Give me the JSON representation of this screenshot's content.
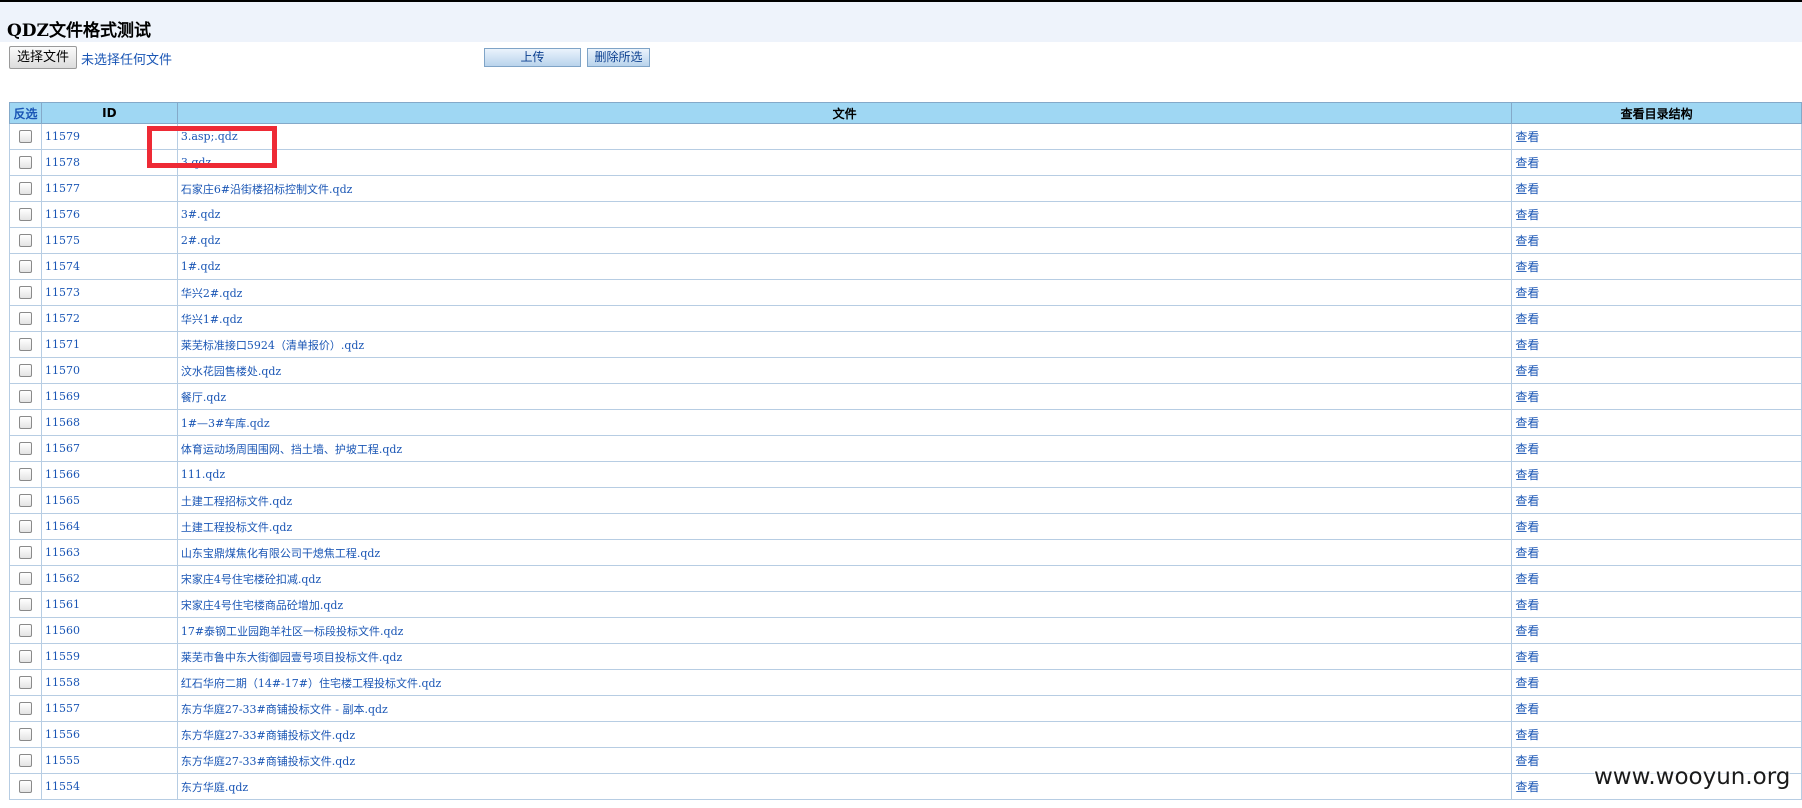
{
  "page": {
    "title": "QDZ文件格式测试"
  },
  "toolbar": {
    "choose_file_label": "选择文件",
    "no_file_text": "未选择任何文件",
    "upload_label": "上传",
    "delete_selected_label": "删除所选"
  },
  "table": {
    "headers": {
      "invert": "反选",
      "id": "ID",
      "file": "文件",
      "view_dir": "查看目录结构"
    },
    "view_label": "查看",
    "rows": [
      {
        "id": "11579",
        "file": "3.asp;.qdz"
      },
      {
        "id": "11578",
        "file": "3.qdz"
      },
      {
        "id": "11577",
        "file": "石家庄6#沿街楼招标控制文件.qdz"
      },
      {
        "id": "11576",
        "file": "3#.qdz"
      },
      {
        "id": "11575",
        "file": "2#.qdz"
      },
      {
        "id": "11574",
        "file": "1#.qdz"
      },
      {
        "id": "11573",
        "file": "华兴2#.qdz"
      },
      {
        "id": "11572",
        "file": "华兴1#.qdz"
      },
      {
        "id": "11571",
        "file": "莱芜标准接口5924（清单报价）.qdz"
      },
      {
        "id": "11570",
        "file": "汶水花园售楼处.qdz"
      },
      {
        "id": "11569",
        "file": "餐厅.qdz"
      },
      {
        "id": "11568",
        "file": "1#—3#车库.qdz"
      },
      {
        "id": "11567",
        "file": "体育运动场周围围网、挡土墙、护坡工程.qdz"
      },
      {
        "id": "11566",
        "file": "111.qdz"
      },
      {
        "id": "11565",
        "file": "土建工程招标文件.qdz"
      },
      {
        "id": "11564",
        "file": "土建工程投标文件.qdz"
      },
      {
        "id": "11563",
        "file": "山东宝鼎煤焦化有限公司干熄焦工程.qdz"
      },
      {
        "id": "11562",
        "file": "宋家庄4号住宅楼砼扣减.qdz"
      },
      {
        "id": "11561",
        "file": "宋家庄4号住宅楼商品砼增加.qdz"
      },
      {
        "id": "11560",
        "file": "17#泰钢工业园跑羊社区一标段投标文件.qdz"
      },
      {
        "id": "11559",
        "file": "莱芜市鲁中东大街御园壹号项目投标文件.qdz"
      },
      {
        "id": "11558",
        "file": "红石华府二期（14#-17#）住宅楼工程投标文件.qdz"
      },
      {
        "id": "11557",
        "file": "东方华庭27-33#商铺投标文件 - 副本.qdz"
      },
      {
        "id": "11556",
        "file": "东方华庭27-33#商铺投标文件.qdz"
      },
      {
        "id": "11555",
        "file": "东方华庭27-33#商铺投标文件.qdz"
      },
      {
        "id": "11554",
        "file": "东方华庭.qdz"
      }
    ]
  },
  "watermark": "www.wooyun.org",
  "colors": {
    "header_bg": "#9fd7f3",
    "link": "#1a56b5",
    "highlight": "#ee2a35"
  }
}
